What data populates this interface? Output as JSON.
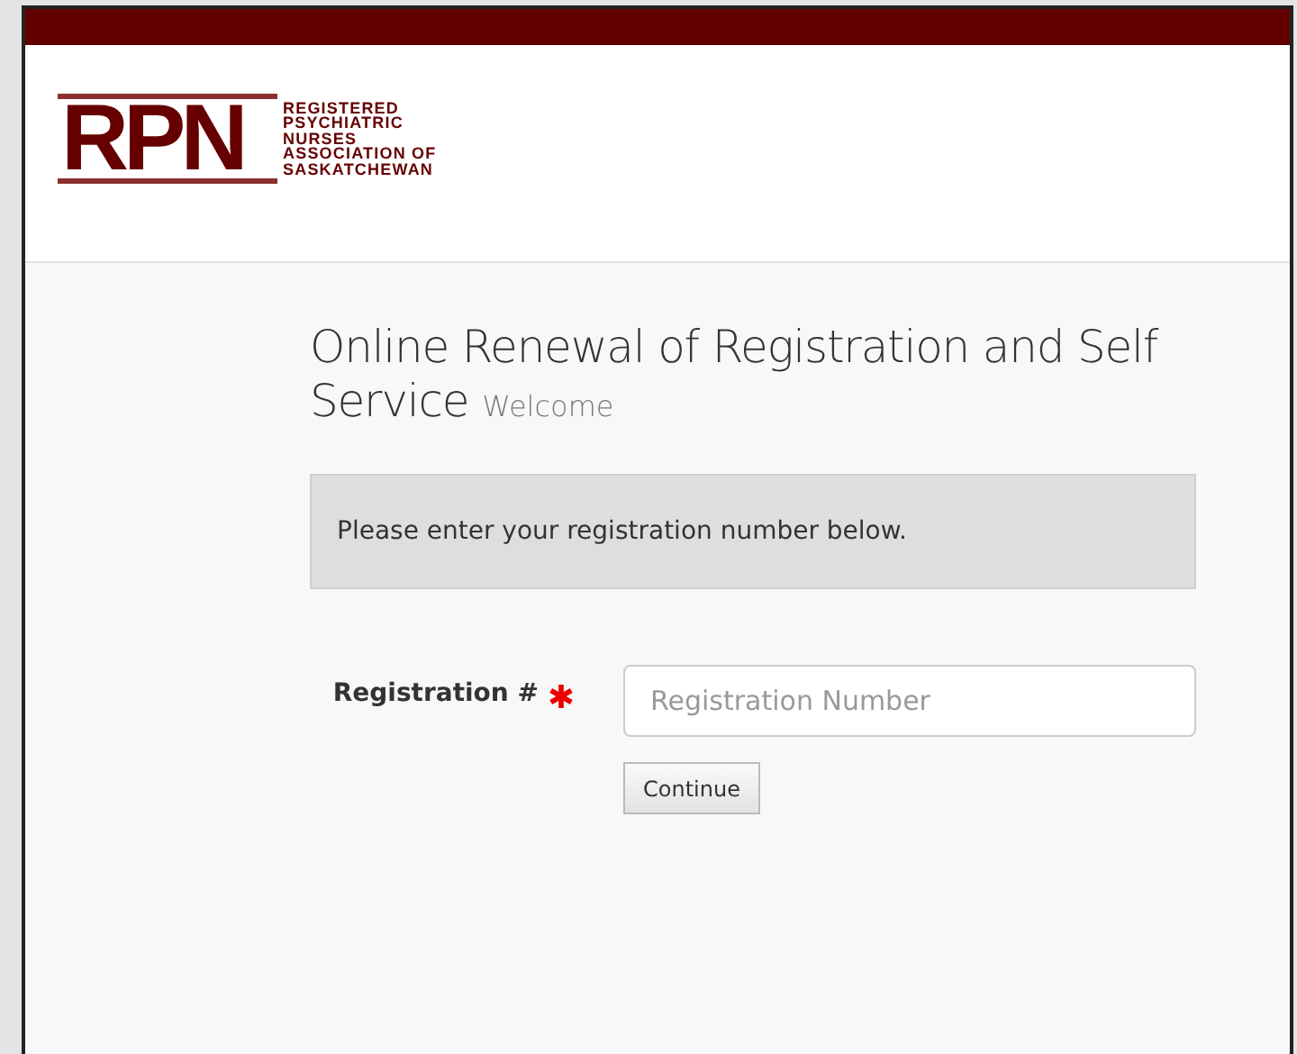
{
  "logo": {
    "initials": "RPN",
    "lines": [
      "REGISTERED",
      "PSYCHIATRIC",
      "NURSES",
      "ASSOCIATION OF",
      "SASKATCHEWAN"
    ]
  },
  "heading": {
    "title": "Online Renewal of Registration and Self Service",
    "subtitle": "Welcome"
  },
  "notice": "Please enter your registration number below.",
  "form": {
    "label": "Registration #",
    "required": true,
    "placeholder": "Registration Number",
    "button": "Continue"
  }
}
